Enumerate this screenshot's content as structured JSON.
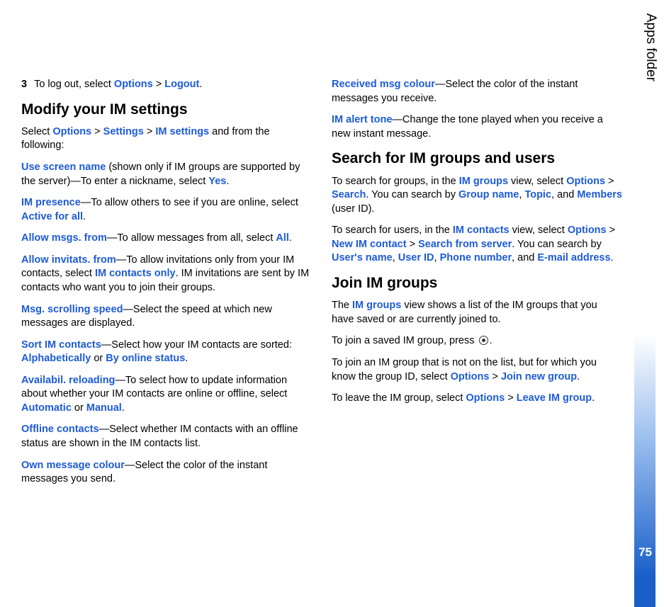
{
  "sidebar": {
    "label": "Apps folder",
    "page_number": "75"
  },
  "col1": {
    "step3": {
      "num": "3",
      "t1": "To log out, select ",
      "options": "Options",
      "gt": " > ",
      "logout": "Logout",
      "t2": "."
    },
    "h_modify": "Modify your IM settings",
    "p_settings": {
      "t1": "Select ",
      "options": "Options",
      "gt1": " > ",
      "settings": "Settings",
      "gt2": " > ",
      "im_settings": "IM settings",
      "t2": " and from the following:"
    },
    "p_screen": {
      "label": "Use screen name",
      "t1": " (shown only if IM groups are supported by the server)—To enter a nickname, select ",
      "yes": "Yes",
      "t2": "."
    },
    "p_presence": {
      "label": "IM presence",
      "t1": "—To allow others to see if you are online, select ",
      "active": "Active for all",
      "t2": "."
    },
    "p_allowmsg": {
      "label": "Allow msgs. from",
      "t1": "—To allow messages from all, select ",
      "all": "All",
      "t2": "."
    },
    "p_allowinv": {
      "label": "Allow invitats. from",
      "t1": "—To allow invitations only from your IM contacts, select ",
      "only": "IM contacts only",
      "t2": ". IM invitations are sent by IM contacts who want you to join their groups."
    },
    "p_scroll": {
      "label": "Msg. scrolling speed",
      "t1": "—Select the speed at which new messages are displayed."
    },
    "p_sort": {
      "label": "Sort IM contacts",
      "t1": "—Select how your IM contacts are sorted: ",
      "alpha": "Alphabetically",
      "or": " or ",
      "online": "By online status",
      "t2": "."
    },
    "p_avail": {
      "label": "Availabil. reloading",
      "t1": "—To select how to update information about whether your IM contacts are online or offline, select ",
      "auto": "Automatic",
      "or": " or ",
      "manual": "Manual",
      "t2": "."
    },
    "p_offline": {
      "label": "Offline contacts",
      "t1": "—Select whether IM contacts with an offline status are shown in the IM contacts list."
    },
    "p_own": {
      "label": "Own message colour",
      "t1": "—Select the color of the instant messages you send."
    }
  },
  "col2": {
    "p_recv": {
      "label": "Received msg colour",
      "t1": "—Select the color of the instant messages you receive."
    },
    "p_alert": {
      "label": "IM alert tone",
      "t1": "—Change the tone played when you receive a new instant message."
    },
    "h_search": "Search for IM groups and users",
    "p_sgroups": {
      "t1": "To search for groups, in the ",
      "imgroups": "IM groups",
      "t2": " view, select ",
      "options": "Options",
      "gt": " > ",
      "search": "Search",
      "t3": ". You can search by ",
      "gname": "Group name",
      "c1": ", ",
      "topic": "Topic",
      "c2": ", and ",
      "members": "Members",
      "t4": " (user ID)."
    },
    "p_susers": {
      "t1": "To search for users, in the ",
      "imcontacts": "IM contacts",
      "t2": " view, select ",
      "options": "Options",
      "gt1": " > ",
      "newcontact": "New IM contact",
      "gt2": " > ",
      "sfs": "Search from server",
      "t3": ". You can search by ",
      "uname": "User's name",
      "c1": ", ",
      "uid": "User ID",
      "c2": ", ",
      "phone": "Phone number",
      "c3": ", and ",
      "email": "E-mail address",
      "t4": "."
    },
    "h_join": "Join IM groups",
    "p_join1": {
      "t1": "The ",
      "imgroups": "IM groups",
      "t2": " view shows a list of the IM groups that you have saved or are currently joined to."
    },
    "p_join2": {
      "t1": "To join a saved IM group, press ",
      "t2": "."
    },
    "p_join3": {
      "t1": "To join an IM group that is not on the list, but for which you know the group ID, select ",
      "options": "Options",
      "gt": " > ",
      "jng": "Join new group",
      "t2": "."
    },
    "p_join4": {
      "t1": "To leave the IM group, select ",
      "options": "Options",
      "gt": " > ",
      "leave": "Leave IM group",
      "t2": "."
    }
  }
}
